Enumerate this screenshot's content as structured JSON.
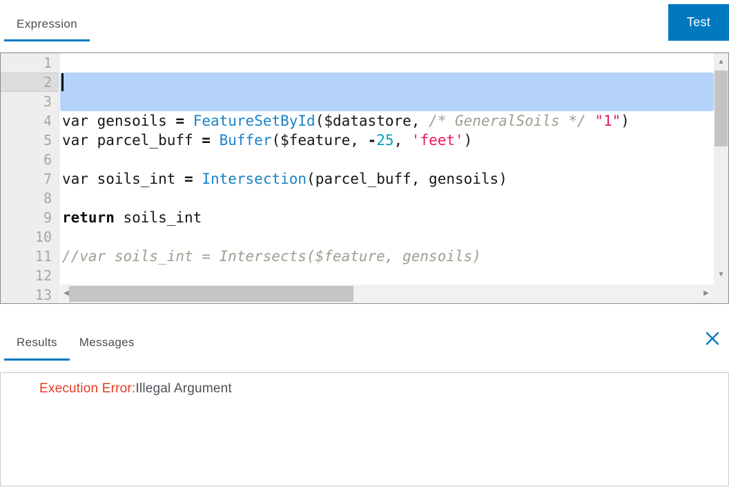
{
  "colors": {
    "accent_blue": "#0079c1",
    "selection_blue": "#b5d3fa",
    "function_blue": "#1a82c8",
    "number_teal": "#00a0b4",
    "string_pink": "#e8185d",
    "comment_gray": "#9e9e90",
    "error_red": "#e33b23"
  },
  "header": {
    "tabs": [
      {
        "label": "Expression",
        "active": true
      }
    ],
    "test_button_label": "Test"
  },
  "editor": {
    "line_numbers": [
      "1",
      "2",
      "3",
      "4",
      "5",
      "6",
      "7",
      "8",
      "9",
      "10",
      "11",
      "12",
      "13"
    ],
    "active_line_number": 2,
    "selection_lines": [
      2,
      3
    ],
    "code_lines": [
      {
        "n": 1,
        "tokens": []
      },
      {
        "n": 2,
        "tokens": []
      },
      {
        "n": 3,
        "tokens": []
      },
      {
        "n": 4,
        "tokens": [
          {
            "type": "plain",
            "text": "var gensoils "
          },
          {
            "type": "op",
            "text": "="
          },
          {
            "type": "plain",
            "text": " "
          },
          {
            "type": "fn",
            "text": "FeatureSetById"
          },
          {
            "type": "plain",
            "text": "($datastore, "
          },
          {
            "type": "com",
            "text": "/* GeneralSoils */"
          },
          {
            "type": "plain",
            "text": " "
          },
          {
            "type": "str",
            "text": "\"1\""
          },
          {
            "type": "plain",
            "text": ")"
          }
        ]
      },
      {
        "n": 5,
        "tokens": [
          {
            "type": "plain",
            "text": "var parcel_buff "
          },
          {
            "type": "op",
            "text": "="
          },
          {
            "type": "plain",
            "text": " "
          },
          {
            "type": "fn",
            "text": "Buffer"
          },
          {
            "type": "plain",
            "text": "($feature, "
          },
          {
            "type": "op",
            "text": "-"
          },
          {
            "type": "num",
            "text": "25"
          },
          {
            "type": "plain",
            "text": ", "
          },
          {
            "type": "str",
            "text": "'feet'"
          },
          {
            "type": "plain",
            "text": ")"
          }
        ]
      },
      {
        "n": 6,
        "tokens": []
      },
      {
        "n": 7,
        "tokens": [
          {
            "type": "plain",
            "text": "var soils_int "
          },
          {
            "type": "op",
            "text": "="
          },
          {
            "type": "plain",
            "text": " "
          },
          {
            "type": "fn",
            "text": "Intersection"
          },
          {
            "type": "plain",
            "text": "(parcel_buff, gensoils)"
          }
        ]
      },
      {
        "n": 8,
        "tokens": []
      },
      {
        "n": 9,
        "tokens": [
          {
            "type": "kw",
            "text": "return"
          },
          {
            "type": "plain",
            "text": " soils_int"
          }
        ]
      },
      {
        "n": 10,
        "tokens": []
      },
      {
        "n": 11,
        "tokens": [
          {
            "type": "com",
            "text": "//var soils_int = Intersects($feature, gensoils)"
          }
        ]
      },
      {
        "n": 12,
        "tokens": []
      },
      {
        "n": 13,
        "tokens": []
      }
    ],
    "scrollbar_icons": {
      "up": "▲",
      "down": "▼",
      "left": "◀",
      "right": "▶"
    }
  },
  "results": {
    "tabs": [
      {
        "label": "Results",
        "active": true
      },
      {
        "label": "Messages",
        "active": false
      }
    ],
    "error_label": "Execution Error:",
    "error_message": "Illegal Argument"
  }
}
